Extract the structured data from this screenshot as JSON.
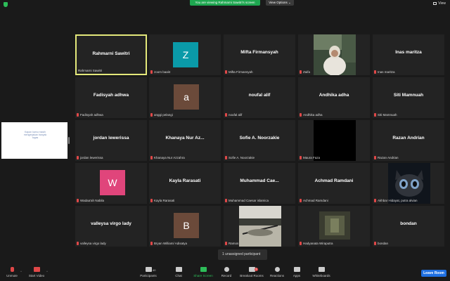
{
  "banner": {
    "viewing": "You are viewing Rahmarni Sawitri's screen",
    "view_options": "View Options ⌄",
    "view": "View"
  },
  "share": {
    "text": "Kapan kamu masih mengerjakan banyak tugas"
  },
  "tiles": [
    {
      "name": "Rahmarni Sawitri",
      "label": "Rahmarni Sawitri"
    },
    {
      "avatar": "Z",
      "label": "zoom baal4"
    },
    {
      "name": "Mifta Firmansyah",
      "label": "Mifta Firmansyah"
    },
    {
      "label": "Zaifa"
    },
    {
      "name": "Inas maritza",
      "label": "Inas maritza"
    },
    {
      "name": "Fadisyah adhwa",
      "label": "Fadisyah adhwa"
    },
    {
      "avatar": "a",
      "label": "anggi pelangi"
    },
    {
      "name": "noufal alif",
      "label": "noufal alif"
    },
    {
      "name": "Andhika adha",
      "label": "Andhika adha"
    },
    {
      "name": "Siti Mamnuah",
      "label": "Siti Mamnuah"
    },
    {
      "name": "jordan lewerissa",
      "label": "jordan lewerissa"
    },
    {
      "name": "Khanaya Nur Az...",
      "label": "Khanaya Nur Azzahra"
    },
    {
      "name": "Sofie A. Noorzakie",
      "label": "Sofie A. Noorzakie"
    },
    {
      "label": "Maura Faza"
    },
    {
      "name": "Razan Andrian",
      "label": "Razan Andrian"
    },
    {
      "avatar": "W",
      "label": "Wadaa'ah Nabila"
    },
    {
      "name": "Kayla Rarasati",
      "label": "Kayla Rarasati"
    },
    {
      "name": "Muhammad Cae...",
      "label": "Muhammad Caesar islamica"
    },
    {
      "name": "Achmad Ramdani",
      "label": "Achmad Ramdani"
    },
    {
      "label": "Akhbar Hidayat, putra alvian"
    },
    {
      "name": "valleysa virgo lady",
      "label": "valleysa virgo lady"
    },
    {
      "avatar": "B",
      "label": "Bryan William/ Adisatya"
    },
    {
      "label": "Ramos"
    },
    {
      "label": "Hadyanata Wiraputra"
    },
    {
      "name": "bondan",
      "label": "bondan"
    }
  ],
  "tooltip": "1 unassigned participant",
  "toolbar": {
    "unmute": "Unmute",
    "start_video": "Start Video",
    "participants": "Participants",
    "participants_count": "40",
    "chat": "Chat",
    "share_screen": "Share Screen",
    "record": "Record",
    "breakout": "Breakout Rooms",
    "reactions": "Reactions",
    "apps": "Apps",
    "whiteboards": "Whiteboards",
    "leave": "Leave Room"
  },
  "colors": {
    "active_border": "#e3e87a",
    "green": "#2dbd59",
    "leave": "#1f6fe0",
    "avatar_z": "#0a9aa8",
    "avatar_a": "#6b4a3a",
    "avatar_w": "#e0457b",
    "avatar_b": "#6b4a3a"
  }
}
